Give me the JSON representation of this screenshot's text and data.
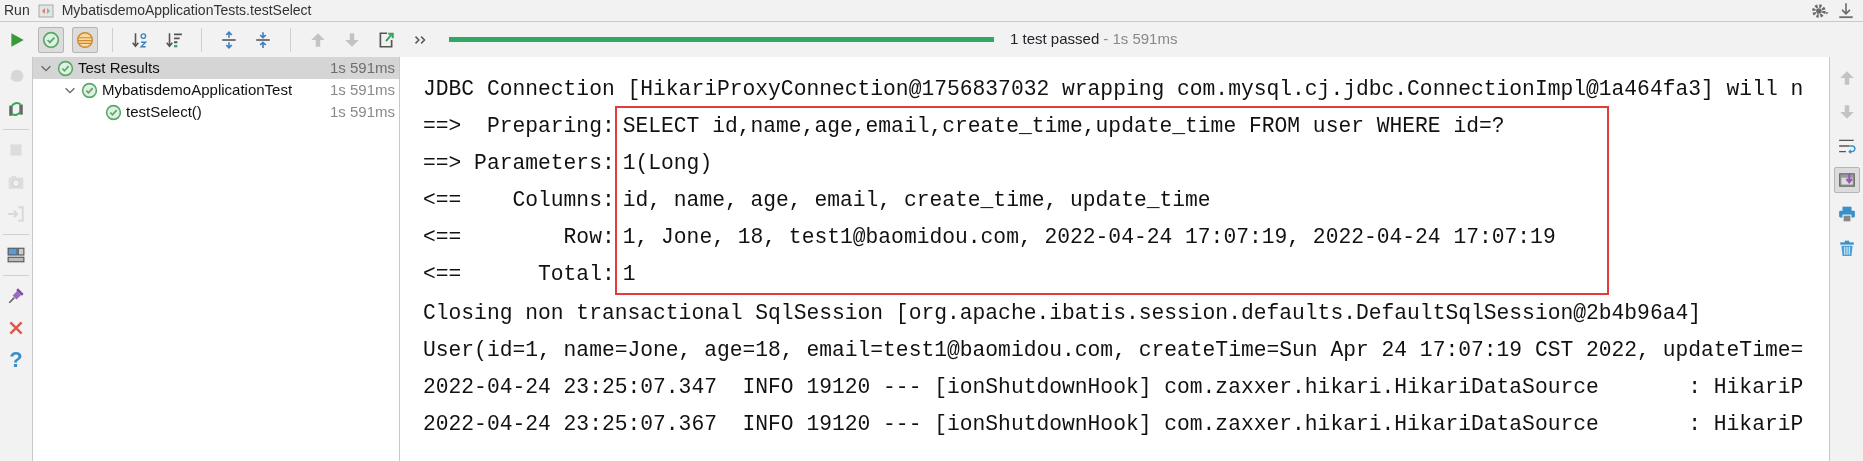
{
  "window": {
    "tab_label": "Run",
    "config_name": "MybatisdemoApplicationTests.testSelect"
  },
  "window_tools": [
    {
      "kind": "gear"
    },
    {
      "kind": "hide"
    }
  ],
  "toolbar": {
    "groups": [
      {
        "tools": [
          {
            "kind": "run",
            "on": false,
            "disabled": false
          },
          {
            "kind": "show-passed",
            "on": true,
            "disabled": false
          },
          {
            "kind": "show-ignored",
            "on": true,
            "disabled": false
          }
        ]
      },
      {
        "tools": [
          {
            "kind": "sort-alpha",
            "on": false,
            "disabled": false
          },
          {
            "kind": "sort-duration",
            "on": false,
            "disabled": false
          }
        ]
      },
      {
        "tools": [
          {
            "kind": "expand-all",
            "on": false,
            "disabled": false
          },
          {
            "kind": "collapse-all",
            "on": false,
            "disabled": false
          }
        ]
      },
      {
        "tools": [
          {
            "kind": "previous",
            "on": false,
            "disabled": true
          },
          {
            "kind": "next",
            "on": false,
            "disabled": true
          },
          {
            "kind": "export",
            "on": false,
            "disabled": false
          },
          {
            "kind": "more",
            "on": false,
            "disabled": false
          }
        ]
      }
    ]
  },
  "progress": {
    "level": 1,
    "status": "1 test passed",
    "duration": "- 1s 591ms"
  },
  "side_tools": {
    "groups": [
      {
        "tools": [
          {
            "kind": "chat",
            "disabled": true
          },
          {
            "kind": "rerun",
            "disabled": false
          }
        ]
      },
      {
        "tools": [
          {
            "kind": "stop",
            "disabled": true
          },
          {
            "kind": "camera",
            "disabled": true
          },
          {
            "kind": "import",
            "disabled": true
          }
        ]
      },
      {
        "tools": [
          {
            "kind": "layout",
            "disabled": false
          }
        ]
      },
      {
        "tools": [
          {
            "kind": "pin",
            "disabled": false
          },
          {
            "kind": "close",
            "disabled": false
          },
          {
            "kind": "help",
            "disabled": false,
            "glyph": "?"
          }
        ]
      }
    ]
  },
  "tree": [
    {
      "label": "Test Results",
      "duration": "1s 591ms",
      "selected": true,
      "expanded": true,
      "children": [
        {
          "label": "MybatisdemoApplicationTest",
          "duration": "1s 591ms",
          "selected": false,
          "expanded": true,
          "children": [
            {
              "label": "testSelect()",
              "duration": "1s 591ms",
              "selected": false
            }
          ]
        }
      ]
    }
  ],
  "console": {
    "lines_before": [
      "JDBC Connection [HikariProxyConnection@1756837032 wrapping com.mysql.cj.jdbc.ConnectionImpl@1a464fa3] will n"
    ],
    "highlight": [
      {
        "prefix": "==>  Preparing:",
        "text": "SELECT id,name,age,email,create_time,update_time FROM user WHERE id=?"
      },
      {
        "prefix": "==> Parameters:",
        "text": "1(Long)"
      },
      {
        "prefix": "<==    Columns:",
        "text": "id, name, age, email, create_time, update_time"
      },
      {
        "prefix": "<==        Row:",
        "text": "1, Jone, 18, test1@baomidou.com, 2022-04-24 17:07:19, 2022-04-24 17:07:19"
      },
      {
        "prefix": "<==      Total:",
        "text": "1"
      }
    ],
    "lines_after": [
      "Closing non transactional SqlSession [org.apache.ibatis.session.defaults.DefaultSqlSession@2b4b96a4]",
      "User(id=1, name=Jone, age=18, email=test1@baomidou.com, createTime=Sun Apr 24 17:07:19 CST 2022, updateTime=",
      "2022-04-24 23:25:07.347  INFO 19120 --- [ionShutdownHook] com.zaxxer.hikari.HikariDataSource       : HikariP",
      "2022-04-24 23:25:07.367  INFO 19120 --- [ionShutdownHook] com.zaxxer.hikari.HikariDataSource       : HikariP"
    ]
  },
  "console_tools": [
    {
      "kind": "previous",
      "on": false,
      "disabled": true
    },
    {
      "kind": "next",
      "on": false,
      "disabled": true
    },
    {
      "kind": "wrap",
      "on": false,
      "disabled": false
    },
    {
      "kind": "scroll-end",
      "on": true,
      "disabled": false
    },
    {
      "kind": "print",
      "on": false,
      "disabled": false
    },
    {
      "kind": "trash",
      "on": false,
      "disabled": false
    }
  ]
}
